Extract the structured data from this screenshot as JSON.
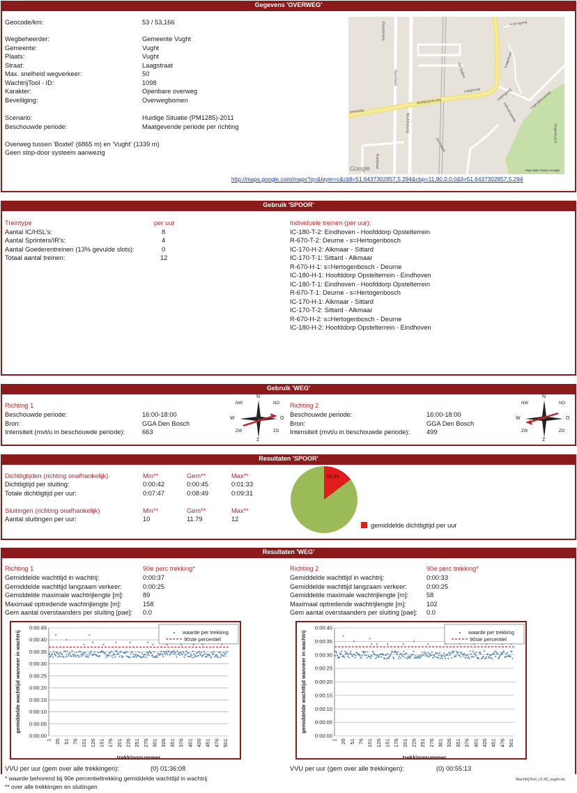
{
  "overweg": {
    "header": "Gegevens 'OVERWEG'",
    "rows": [
      {
        "label": "Geocode/km:",
        "value": "53 / 53,166"
      },
      {
        "label": "Wegbeheerder:",
        "value": "Gemeente Vught"
      },
      {
        "label": "Gemeente:",
        "value": "Vught"
      },
      {
        "label": "Plaats:",
        "value": "Vught"
      },
      {
        "label": "Straat:",
        "value": "Laagstraat"
      },
      {
        "label": "Max. snelheid wegverkeer:",
        "value": "50"
      },
      {
        "label": "WachtrijTool - ID:",
        "value": "1098"
      },
      {
        "label": "Karakter:",
        "value": "Openbare overweg"
      },
      {
        "label": "Beveiliging:",
        "value": "Overwegbomen"
      },
      {
        "label": "Scenario:",
        "value": "Huidige Situatie (PM1285)-2011"
      },
      {
        "label": "Beschouwde periode:",
        "value": "Maatgevende periode per richting"
      }
    ],
    "note1": "Overweg tussen 'Boxtel' (6865 m) en 'Vught' (1339 m)",
    "note2": "Geen stop-door systeem aanwezig",
    "map_link": "http://maps.google.com/maps?q=&layer=c&cbll=51.6437302857,5.294&cbp=11,90,0,0,0&ll=51.6437302857,5.294",
    "map_labels": [
      "Laagstraat",
      "Laagstraat",
      "Wolfskamerweg",
      "smerweg",
      "Kattingweg",
      "Kattingweg",
      "Lagedijkenstraat",
      "Spoorlaan",
      "Boxtelseweg",
      "De Spijker",
      "Koestraat",
      "Helvoirtseweg",
      "Hogenbosch",
      "Kloosterlaan",
      "De Keijzer"
    ],
    "map_logo": "Google",
    "map_copyright": "Map data ©2012 Google"
  },
  "spoor": {
    "header": "Gebruik 'SPOOR'",
    "col_treintype": "Treintype",
    "col_peruur": "per uur",
    "col_indiv": "Individuele treinen (per uur):",
    "rows": [
      {
        "label": "Aantal IC/HSL's:",
        "value": "8"
      },
      {
        "label": "Aantal Sprinters/IR's:",
        "value": "4"
      },
      {
        "label": "Aantal Goederentreinen (13% gevulde slots):",
        "value": "0"
      },
      {
        "label": "Totaal aantal treinen:",
        "value": "12"
      }
    ],
    "trains": [
      "IC-180-T-2: Eindhoven - Hoofddorp Opstelterrein",
      "R-670-T-2: Deurne - s=Hertogenbosch",
      "IC-170-H-2: Alkmaar - Sittard",
      "IC-170-T-1: Sittard - Alkmaar",
      "R-670-H-1: s=Hertogenbosch - Deurne",
      "IC-180-H-1: Hoofddorp Opstelterrein - Eindhoven",
      "IC-180-T-1: Eindhoven - Hoofddorp Opstelterrein",
      "R-670-T-1: Deurne - s=Hertogenbosch",
      "IC-170-H-1: Alkmaar - Sittard",
      "IC-170-T-2: Sittard - Alkmaar",
      "R-670-H-2: s=Hertogenbosch - Deurne",
      "IC-180-H-2: Hoofddorp Opstelterrein - Eindhoven"
    ]
  },
  "weg": {
    "header": "Gebruik 'WEG'",
    "richtingen": [
      {
        "title": "Richting 1",
        "periode_label": "Beschouwde periode:",
        "periode": "16:00-18:00",
        "bron_label": "Bron:",
        "bron": "GGA Den Bosch",
        "int_label": "Intensiteit (mvt/u in beschouwde periode):",
        "intensiteit": "663"
      },
      {
        "title": "Richting 2",
        "periode_label": "Beschouwde periode:",
        "periode": "16:00-18:00",
        "bron_label": "Bron:",
        "bron": "GGA Den Bosch",
        "int_label": "Intensiteit (mvt/u in beschouwde periode):",
        "intensiteit": "499"
      }
    ],
    "compass": {
      "N": "N",
      "NO": "NO",
      "O": "O",
      "ZO": "ZO",
      "Z": "Z",
      "ZW": "ZW",
      "W": "W",
      "NW": "NW"
    }
  },
  "res_spoor": {
    "header": "Resultaten  'SPOOR'",
    "dicht_title": "Dichtligtijden (richting onafhankelijk)",
    "sluit_title": "Sluitingen (richting onafhankelijk)",
    "min": "Min**",
    "gem": "Gem**",
    "max": "Max**",
    "rows": [
      {
        "label": "Dichtligtijd per sluiting:",
        "min": "0:00:42",
        "gem": "0:00:45",
        "max": "0:01:33"
      },
      {
        "label": "Totale dichtligtijd per uur:",
        "min": "0:07:47",
        "gem": "0:08:49",
        "max": "0:09:31"
      }
    ],
    "sluit_row": {
      "label": "Aantal sluitingen per uur:",
      "min": "10",
      "gem": "11.79",
      "max": "12"
    },
    "pie_label": "08:49",
    "pie_fraction": 0.147,
    "pie_legend": "gemiddelde dichtligtijd per uur",
    "colors": {
      "closed": "#e01c1c",
      "open": "#9bbb59"
    }
  },
  "res_weg": {
    "header": "Resultaten  'WEG'",
    "perc_label": "90e perc trekking*",
    "row_labels": [
      "Gemiddelde wachttijd in wachtrij:",
      "Gemiddelde wachttijd langzaam verkeer:",
      "Gemiddelde maximale wachtrijlengte [m]:",
      "Maximaal optredende wachtrijlengte [m]:",
      "Gem aantal overstaanders per sluiting [pae]:"
    ],
    "richtingen": [
      {
        "title": "Richting 1",
        "values": [
          "0:00:37",
          "0:00:25",
          "89",
          "158",
          "0.0"
        ],
        "vvu_label": "VVU per uur (gem over alle trekkingen):",
        "vvu": "(0) 01:36:08"
      },
      {
        "title": "Richting 2",
        "values": [
          "0:00:33",
          "0:00:25",
          "58",
          "102",
          "0.0"
        ],
        "vvu_label": "VVU per uur (gem over alle trekkingen):",
        "vvu": "(0) 00:55:13"
      }
    ],
    "footnote1": "* waarde behorend bij 90e percentieltrekking gemiddelde wachttijd in wachtrij",
    "footnote2": "** over alle trekkingen en sluitingen",
    "file_note": "WachtrijTool_v2.30_vught.xls"
  },
  "chart_data": [
    {
      "type": "scatter",
      "title": "",
      "xlabel": "trekkingnummer",
      "ylabel": "gemiddelde wachttijd wanneer in wachtrij",
      "x_ticks": [
        "1",
        "26",
        "51",
        "76",
        "101",
        "126",
        "151",
        "176",
        "201",
        "226",
        "251",
        "276",
        "301",
        "326",
        "351",
        "376",
        "401",
        "426",
        "451",
        "476",
        "501"
      ],
      "y_ticks": [
        "0:00:00",
        "0:00:05",
        "0:00:10",
        "0:00:15",
        "0:00:20",
        "0:00:25",
        "0:00:30",
        "0:00:35",
        "0:00:40",
        "0:00:45"
      ],
      "xlim": [
        1,
        510
      ],
      "ylim_seconds": [
        0,
        45
      ],
      "series": [
        {
          "name": "waarde per trekking",
          "color": "#4f81bd",
          "baseline_seconds": 34,
          "spread_seconds": 1.4,
          "outliers": [
            [
              21,
              42
            ],
            [
              51,
              40
            ],
            [
              101,
              38
            ],
            [
              116,
              42
            ],
            [
              126,
              39
            ],
            [
              156,
              38
            ],
            [
              191,
              39
            ],
            [
              231,
              39
            ],
            [
              281,
              39
            ],
            [
              296,
              38
            ],
            [
              336,
              38
            ],
            [
              376,
              38
            ],
            [
              411,
              38
            ],
            [
              436,
              38
            ],
            [
              476,
              39
            ],
            [
              491,
              38
            ]
          ]
        },
        {
          "name": "90ste percentiel",
          "color": "#c0262d",
          "value_seconds": 37
        }
      ]
    },
    {
      "type": "scatter",
      "title": "",
      "xlabel": "trekkingnummer",
      "ylabel": "gemiddelde wachttijd wanneer in wachtrij",
      "x_ticks": [
        "1",
        "26",
        "51",
        "76",
        "101",
        "126",
        "151",
        "176",
        "201",
        "226",
        "251",
        "276",
        "301",
        "326",
        "351",
        "376",
        "401",
        "426",
        "451",
        "476",
        "501"
      ],
      "y_ticks": [
        "0:00:00",
        "0:00:05",
        "0:00:10",
        "0:00:15",
        "0:00:20",
        "0:00:25",
        "0:00:30",
        "0:00:35",
        "0:00:40"
      ],
      "xlim": [
        1,
        510
      ],
      "ylim_seconds": [
        0,
        40
      ],
      "series": [
        {
          "name": "waarde per trekking",
          "color": "#4f81bd",
          "baseline_seconds": 30,
          "spread_seconds": 1.4,
          "outliers": [
            [
              26,
              37
            ],
            [
              56,
              35
            ],
            [
              101,
              36
            ],
            [
              106,
              34
            ],
            [
              121,
              34
            ],
            [
              151,
              34
            ],
            [
              196,
              34
            ],
            [
              226,
              35
            ],
            [
              266,
              34
            ],
            [
              316,
              34
            ],
            [
              356,
              34
            ],
            [
              396,
              34
            ],
            [
              431,
              34
            ],
            [
              476,
              34
            ],
            [
              501,
              34
            ]
          ]
        },
        {
          "name": "90ste percentiel",
          "color": "#c0262d",
          "value_seconds": 33
        }
      ]
    }
  ]
}
